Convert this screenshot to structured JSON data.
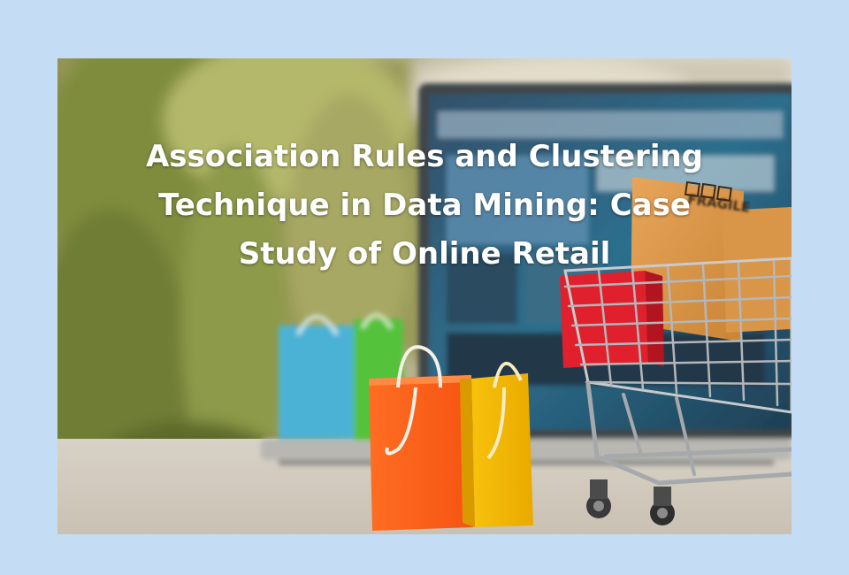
{
  "background_color": "#c4ddf5",
  "headline": {
    "lines": [
      "Association Rules and Clustering",
      "Technique in Data Mining: Case",
      "Study of Online Retail"
    ]
  },
  "photo": {
    "box_label": "FRAGILE",
    "icons": [
      "laptop-icon",
      "shopping-bag-icon",
      "shopping-cart-icon",
      "parcel-box-icon",
      "plant-icon"
    ]
  }
}
